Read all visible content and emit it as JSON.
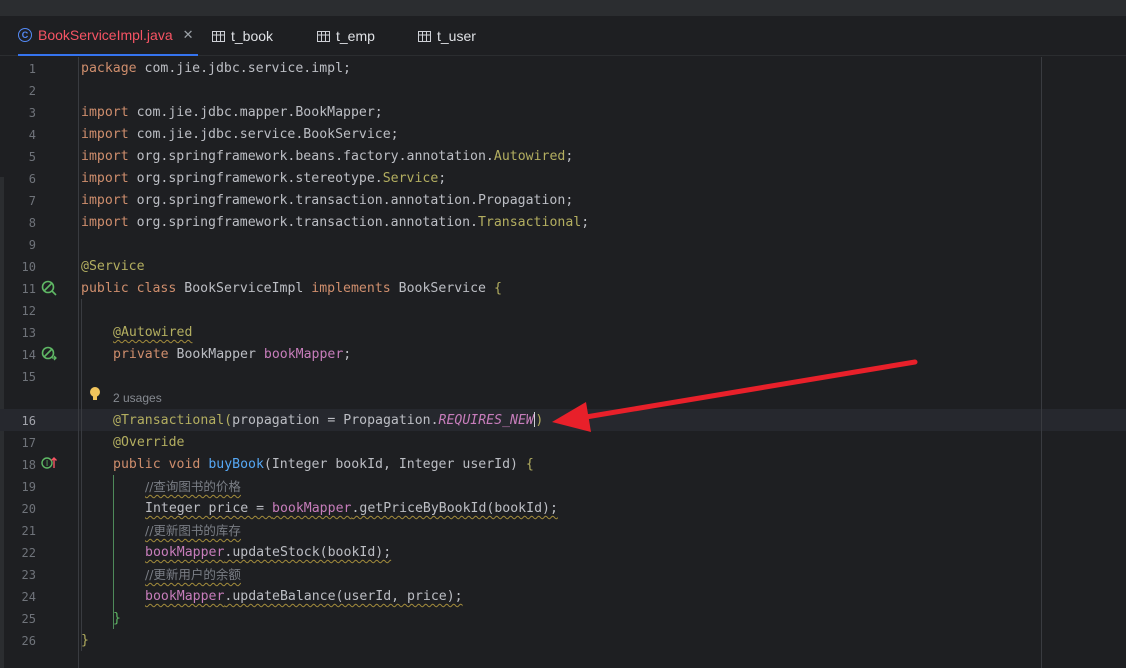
{
  "tabs": [
    {
      "label": "BookServiceImpl.java",
      "icon": "class-icon",
      "active": true
    },
    {
      "label": "t_book",
      "icon": "table-icon"
    },
    {
      "label": "t_emp",
      "icon": "table-icon"
    },
    {
      "label": "t_user",
      "icon": "table-icon"
    }
  ],
  "close_glyph": "✕",
  "line_numbers": [
    "1",
    "2",
    "3",
    "4",
    "5",
    "6",
    "7",
    "8",
    "9",
    "10",
    "11",
    "12",
    "13",
    "14",
    "15",
    "16",
    "17",
    "18",
    "19",
    "20",
    "21",
    "22",
    "23",
    "24",
    "25",
    "26"
  ],
  "inlay_hint": "2 usages",
  "code": {
    "l1": {
      "kw": "package",
      "rest": " com.jie.jdbc.service.impl;"
    },
    "l3": {
      "kw": "import",
      "rest": " com.jie.jdbc.mapper.BookMapper;"
    },
    "l4": {
      "kw": "import",
      "rest": " com.jie.jdbc.service.BookService;"
    },
    "l5": {
      "kw": "import",
      "rest": " org.springframework.beans.factory.annotation.",
      "ann": "Autowired",
      "end": ";"
    },
    "l6": {
      "kw": "import",
      "rest": " org.springframework.stereotype.",
      "ann": "Service",
      "end": ";"
    },
    "l7": {
      "kw": "import",
      "rest": " org.springframework.transaction.annotation.Propagation;"
    },
    "l8": {
      "kw": "import",
      "rest": " org.springframework.transaction.annotation.",
      "ann": "Transactional",
      "end": ";"
    },
    "l10": {
      "ann": "@Service"
    },
    "l11": {
      "kw1": "public",
      "kw2": "class",
      "name": "BookServiceImpl",
      "kw3": "implements",
      "iface": "BookService",
      "brace": "{"
    },
    "l13": {
      "ann": "@Autowired"
    },
    "l14": {
      "kw": "private",
      "type": "BookMapper",
      "field": "bookMapper",
      "end": ";"
    },
    "l16": {
      "ann": "@Transactional",
      "open": "(",
      "param": "propagation = Propagation.",
      "const": "REQUIRES_NEW",
      "close": ")"
    },
    "l17": {
      "ann": "@Override"
    },
    "l18": {
      "kw1": "public",
      "kw2": "void",
      "method": "buyBook",
      "params": "(Integer bookId, Integer userId) ",
      "brace": "{"
    },
    "l19": {
      "comment": "//查询图书的价格"
    },
    "l20": {
      "pre": "Integer price = ",
      "field": "bookMapper",
      "call": ".getPriceByBookId(bookId);"
    },
    "l21": {
      "comment": "//更新图书的库存"
    },
    "l22": {
      "field": "bookMapper",
      "call": ".updateStock(bookId);"
    },
    "l23": {
      "comment": "//更新用户的余额"
    },
    "l24": {
      "field": "bookMapper",
      "call": ".updateBalance(userId, price);"
    },
    "l25": {
      "brace": "}"
    },
    "l26": {
      "brace": "}"
    }
  },
  "colors": {
    "arrow": "#e8202a",
    "accent": "#3574f0",
    "active_tab_text": "#f75464"
  }
}
